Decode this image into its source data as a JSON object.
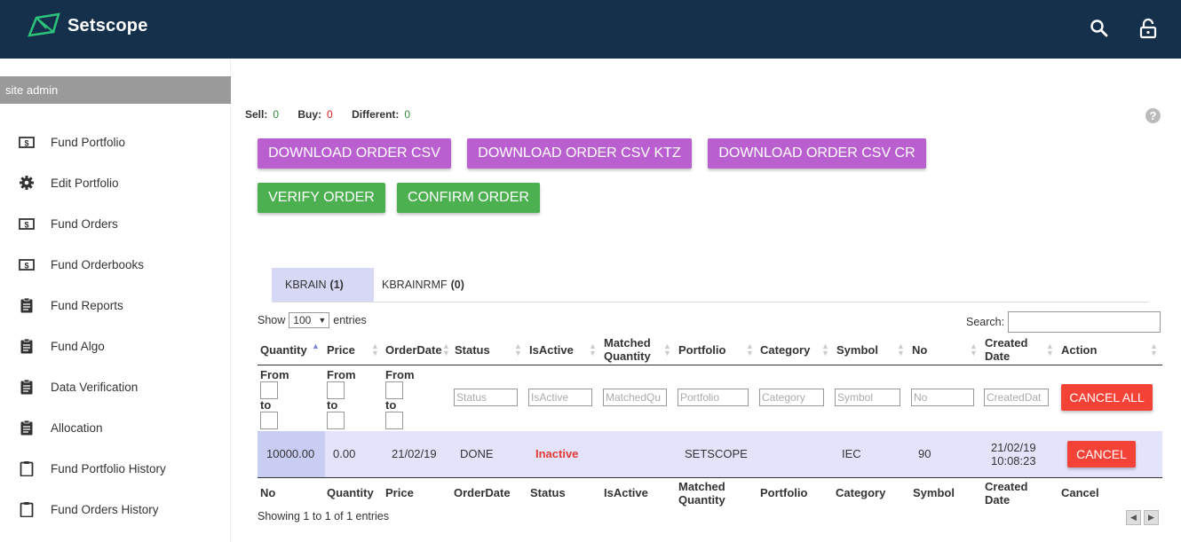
{
  "app": {
    "name": "Setscope"
  },
  "sidebar": {
    "user": "site admin",
    "items": [
      {
        "label": "Fund Portfolio",
        "icon": "dollar-bill-icon"
      },
      {
        "label": "Edit Portfolio",
        "icon": "gear-icon"
      },
      {
        "label": "Fund Orders",
        "icon": "dollar-bill-icon"
      },
      {
        "label": "Fund Orderbooks",
        "icon": "dollar-bill-icon"
      },
      {
        "label": "Fund Reports",
        "icon": "clipboard-icon"
      },
      {
        "label": "Fund Algo",
        "icon": "clipboard-icon"
      },
      {
        "label": "Data Verification",
        "icon": "clipboard-icon"
      },
      {
        "label": "Allocation",
        "icon": "clipboard-icon"
      },
      {
        "label": "Fund Portfolio History",
        "icon": "clipboard-outline-icon"
      },
      {
        "label": "Fund Orders History",
        "icon": "clipboard-outline-icon"
      }
    ]
  },
  "summary": {
    "sell_label": "Sell:",
    "sell_value": "0",
    "buy_label": "Buy:",
    "buy_value": "0",
    "diff_label": "Different:",
    "diff_value": "0",
    "colors": {
      "sell": "#2e8b3a",
      "buy": "#d62020",
      "diff": "#2e8b3a"
    }
  },
  "buttons": {
    "download_csv": "DOWNLOAD ORDER CSV",
    "download_csv_ktz": "DOWNLOAD ORDER CSV KTZ",
    "download_csv_cr": "DOWNLOAD ORDER CSV CR",
    "verify": "VERIFY ORDER",
    "confirm": "CONFIRM ORDER",
    "cancel_all": "CANCEL ALL",
    "cancel": "CANCEL"
  },
  "tabs": [
    {
      "label": "KBRAIN",
      "count": "(1)",
      "active": true
    },
    {
      "label": "KBRAINRMF",
      "count": "(0)",
      "active": false
    }
  ],
  "table": {
    "show_label": "Show",
    "entries_value": "100",
    "entries_label": "entries",
    "search_label": "Search:",
    "headers": [
      "Quantity",
      "Price",
      "OrderDate",
      "Status",
      "IsActive",
      "Matched Quantity",
      "Portfolio",
      "Category",
      "Symbol",
      "No",
      "Created Date",
      "Action"
    ],
    "filter": {
      "from": "From",
      "to": "to",
      "placeholders": [
        "Status",
        "IsActive",
        "MatchedQu",
        "Portfolio",
        "Category",
        "Symbol",
        "No",
        "CreatedDat"
      ]
    },
    "rows": [
      {
        "quantity": "10000.00",
        "price": "0.00",
        "order_date": "21/02/19",
        "status": "DONE",
        "is_active": "Inactive",
        "matched_quantity": "",
        "portfolio": "SETSCOPE",
        "category": "",
        "symbol": "IEC",
        "no": "90",
        "created_date": "21/02/19",
        "created_time": "10:08:23"
      }
    ],
    "footer": [
      "No",
      "Quantity",
      "Price",
      "OrderDate",
      "Status",
      "IsActive",
      "Matched Quantity",
      "Portfolio",
      "Category",
      "Symbol",
      "Created Date",
      "Cancel"
    ],
    "info": "Showing 1 to 1 of 1 entries"
  },
  "help_label": "?"
}
